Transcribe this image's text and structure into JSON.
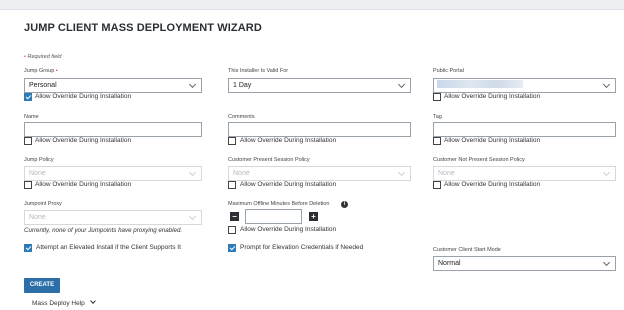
{
  "wizard": {
    "title": "JUMP CLIENT MASS DEPLOYMENT WIZARD",
    "required_note": "Required field",
    "required_mark": "•"
  },
  "allow_override_label": "Allow Override During Installation",
  "fields": {
    "jump_group": {
      "label": "Jump Group",
      "value": "Personal",
      "override": true
    },
    "valid_for": {
      "label": "This Installer Is Valid For",
      "value": "1 Day"
    },
    "public_portal": {
      "label": "Public Portal",
      "value": "",
      "override": false
    },
    "name": {
      "label": "Name",
      "value": "",
      "override": false
    },
    "comments": {
      "label": "Comments",
      "value": "",
      "override": false
    },
    "tag": {
      "label": "Tag",
      "value": "",
      "override": false
    },
    "jump_policy": {
      "label": "Jump Policy",
      "value": "None",
      "override": false
    },
    "present_policy": {
      "label": "Customer Present Session Policy",
      "value": "None",
      "override": false
    },
    "not_present_policy": {
      "label": "Customer Not Present Session Policy",
      "value": "None",
      "override": false
    },
    "jumpoint_proxy": {
      "label": "Jumpoint Proxy",
      "value": "None",
      "note": "Currently, none of your Jumpoints have proxying enabled."
    },
    "max_offline": {
      "label": "Maximum Offline Minutes Before Deletion",
      "value": "",
      "override": false
    },
    "client_start_mode": {
      "label": "Customer Client Start Mode",
      "value": "Normal"
    }
  },
  "options": {
    "elevated_install": {
      "label": "Attempt an Elevated Install if the Client Supports It",
      "checked": true
    },
    "prompt_elevation": {
      "label": "Prompt for Elevation Credentials if Needed",
      "checked": true
    }
  },
  "actions": {
    "create_label": "CREATE",
    "help_label": "Mass Deploy Help"
  },
  "colors": {
    "accent": "#2b6ea8",
    "checkbox": "#2d7bb6",
    "required": "#e0411b"
  }
}
